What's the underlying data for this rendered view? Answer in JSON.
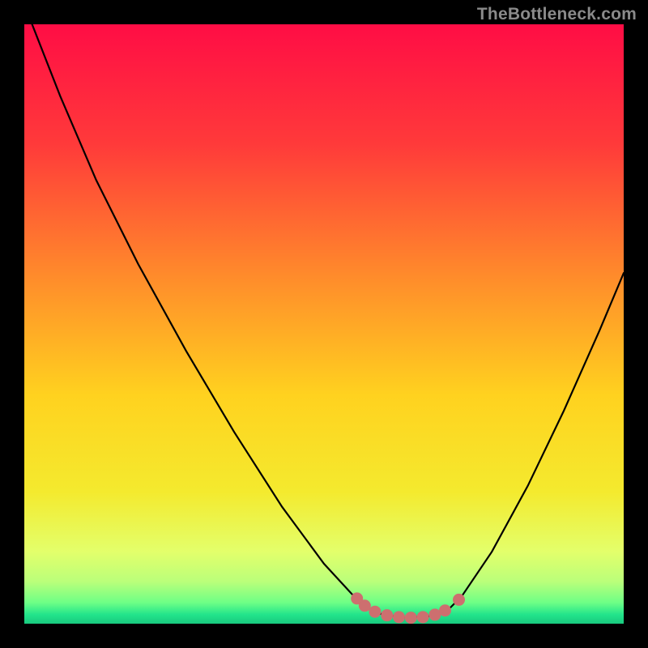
{
  "watermark": "TheBottleneck.com",
  "colors": {
    "page_bg": "#000000",
    "curve": "#000000",
    "marker": "#cd6f6f"
  },
  "chart_data": {
    "type": "line",
    "title": "",
    "xlabel": "",
    "ylabel": "",
    "xlim": [
      0,
      1
    ],
    "ylim": [
      0,
      1
    ],
    "gradient_stops": [
      {
        "offset": 0.0,
        "color": "#ff0d45"
      },
      {
        "offset": 0.2,
        "color": "#ff3a3a"
      },
      {
        "offset": 0.42,
        "color": "#ff8b2b"
      },
      {
        "offset": 0.62,
        "color": "#ffd21f"
      },
      {
        "offset": 0.78,
        "color": "#f4ea2e"
      },
      {
        "offset": 0.88,
        "color": "#e3ff6b"
      },
      {
        "offset": 0.93,
        "color": "#baff7a"
      },
      {
        "offset": 0.965,
        "color": "#6dff86"
      },
      {
        "offset": 0.985,
        "color": "#22e48b"
      },
      {
        "offset": 1.0,
        "color": "#19c97e"
      }
    ],
    "curve_points": [
      {
        "x": 0.013,
        "y": 1.0
      },
      {
        "x": 0.06,
        "y": 0.88
      },
      {
        "x": 0.12,
        "y": 0.74
      },
      {
        "x": 0.19,
        "y": 0.6
      },
      {
        "x": 0.27,
        "y": 0.455
      },
      {
        "x": 0.35,
        "y": 0.32
      },
      {
        "x": 0.43,
        "y": 0.195
      },
      {
        "x": 0.5,
        "y": 0.1
      },
      {
        "x": 0.546,
        "y": 0.05
      },
      {
        "x": 0.57,
        "y": 0.028
      },
      {
        "x": 0.6,
        "y": 0.014
      },
      {
        "x": 0.64,
        "y": 0.01
      },
      {
        "x": 0.68,
        "y": 0.013
      },
      {
        "x": 0.71,
        "y": 0.026
      },
      {
        "x": 0.73,
        "y": 0.046
      },
      {
        "x": 0.78,
        "y": 0.12
      },
      {
        "x": 0.84,
        "y": 0.23
      },
      {
        "x": 0.9,
        "y": 0.355
      },
      {
        "x": 0.96,
        "y": 0.49
      },
      {
        "x": 1.0,
        "y": 0.585
      }
    ],
    "marker_points": [
      {
        "x": 0.555,
        "y": 0.042
      },
      {
        "x": 0.568,
        "y": 0.03
      },
      {
        "x": 0.585,
        "y": 0.02
      },
      {
        "x": 0.605,
        "y": 0.014
      },
      {
        "x": 0.625,
        "y": 0.011
      },
      {
        "x": 0.645,
        "y": 0.01
      },
      {
        "x": 0.665,
        "y": 0.011
      },
      {
        "x": 0.685,
        "y": 0.015
      },
      {
        "x": 0.702,
        "y": 0.022
      },
      {
        "x": 0.725,
        "y": 0.04
      }
    ]
  }
}
